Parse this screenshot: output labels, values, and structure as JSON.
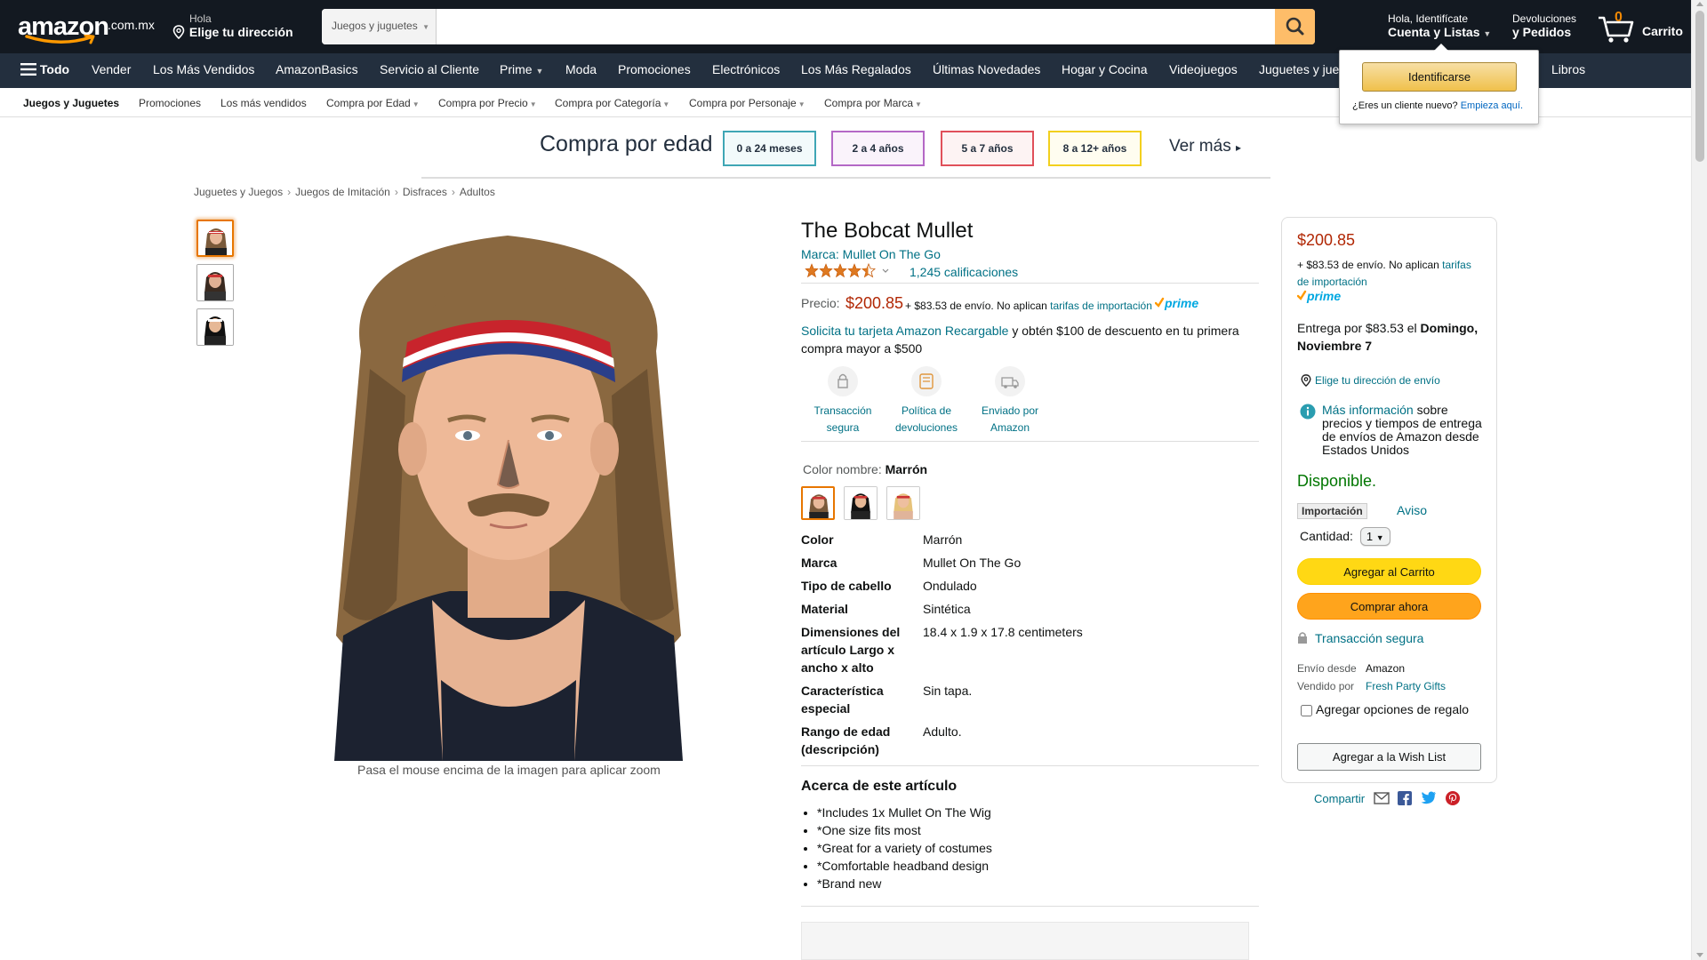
{
  "header": {
    "logo_text": "amazon",
    "logo_tld": ".com.mx",
    "deliver_line1": "Hola",
    "deliver_line2": "Elige tu dirección",
    "search_category": "Juegos y juguetes",
    "search_value": "",
    "account_line1": "Hola, Identifícate",
    "account_line2": "Cuenta y Listas",
    "returns_line1": "Devoluciones",
    "returns_line2": "y Pedidos",
    "cart_count": "0",
    "cart_label": "Carrito"
  },
  "nav": {
    "all_label": "Todo",
    "items": [
      "Vender",
      "Los Más Vendidos",
      "AmazonBasics",
      "Servicio al Cliente",
      "Prime",
      "Moda",
      "Promociones",
      "Electrónicos",
      "Los Más Regalados",
      "Últimas Novedades",
      "Hogar y Cocina",
      "Videojuegos",
      "Juguetes y jue",
      "Libros"
    ]
  },
  "subnav": {
    "items": [
      "Juegos y Juguetes",
      "Promociones",
      "Los más vendidos",
      "Compra por Edad",
      "Compra por Precio",
      "Compra por Categoría",
      "Compra por Personaje",
      "Compra por Marca"
    ]
  },
  "age_banner": {
    "title": "Compra por edad",
    "ages": [
      {
        "label": "0 a 24 meses",
        "color": "#3fa6b5"
      },
      {
        "label": "2 a 4 años",
        "color": "#b468c6"
      },
      {
        "label": "5 a 7 años",
        "color": "#e0505a"
      },
      {
        "label": "8 a 12+ años",
        "color": "#f2d01e"
      }
    ],
    "more": "Ver más"
  },
  "breadcrumb": [
    "Juguetes y Juegos",
    "Juegos de Imitación",
    "Disfraces",
    "Adultos"
  ],
  "gallery": {
    "zoom_hint": "Pasa el mouse encima de la imagen para aplicar zoom"
  },
  "product": {
    "title": "The Bobcat Mullet",
    "brand": "Marca: Mullet On The Go",
    "rating": 4.5,
    "rating_count": "1,245 calificaciones",
    "price_label": "Precio:",
    "price": "$200.85",
    "shipping_prefix": "+ $83.53 de envío. No aplican",
    "shipping_link": "tarifas de importación",
    "promo_link": "Solicita tu tarjeta Amazon Recargable",
    "promo_text": "y obtén $100 de descuento en tu primera compra mayor a $500",
    "features": [
      {
        "icon": "lock-icon",
        "line1": "Transacción",
        "line2": "segura"
      },
      {
        "icon": "return-box-icon",
        "line1": "Política de",
        "line2": "devoluciones"
      },
      {
        "icon": "delivery-truck-icon",
        "line1": "Enviado por",
        "line2": "Amazon"
      }
    ],
    "color_label": "Color nombre:",
    "color_value": "Marrón",
    "specs": [
      {
        "k": "Color",
        "v": "Marrón"
      },
      {
        "k": "Marca",
        "v": "Mullet On The Go"
      },
      {
        "k": "Tipo de cabello",
        "v": "Ondulado"
      },
      {
        "k": "Material",
        "v": "Sintética"
      },
      {
        "k": "Dimensiones del artículo Largo x ancho x alto",
        "v": "18.4 x 1.9 x 17.8 centimeters"
      },
      {
        "k": "Característica especial",
        "v": "Sin tapa."
      },
      {
        "k": "Rango de edad (descripción)",
        "v": "Adulto."
      }
    ],
    "about_heading": "Acerca de este artículo",
    "bullets": [
      "*Includes 1x Mullet On The Wig",
      "*One size fits most",
      "*Great for a variety of costumes",
      "*Comfortable headband design",
      "*Brand new"
    ]
  },
  "buybox": {
    "price": "$200.85",
    "shipping_prefix": "+ $83.53 de envío. No aplican",
    "shipping_link": "tarifas de importación",
    "delivery_prefix": "Entrega por $83.53 el",
    "delivery_date": "Domingo, Noviembre 7",
    "address_link": "Elige tu dirección de envío",
    "info_link": "Más información",
    "info_text": "sobre precios y tiempos de entrega de envíos de Amazon desde Estados Unidos",
    "availability": "Disponible.",
    "import_tag": "Importación",
    "import_link": "Aviso",
    "qty_label": "Cantidad:",
    "qty_value": "1",
    "add_to_cart": "Agregar al Carrito",
    "buy_now": "Comprar ahora",
    "secure": "Transacción segura",
    "ships_from_label": "Envío desde",
    "ships_from": "Amazon",
    "sold_by_label": "Vendido por",
    "sold_by": "Fresh Party Gifts",
    "gift_label": "Agregar opciones de regalo",
    "wishlist": "Agregar a la Wish List",
    "share_label": "Compartir"
  },
  "flyout": {
    "signin": "Identificarse",
    "new_customer": "¿Eres un cliente nuevo?",
    "start_here": "Empieza aquí."
  },
  "colors": {
    "header_bg": "#131921",
    "nav_bg": "#232f3e",
    "price": "#b12704",
    "link": "#007185",
    "available": "#007600"
  }
}
